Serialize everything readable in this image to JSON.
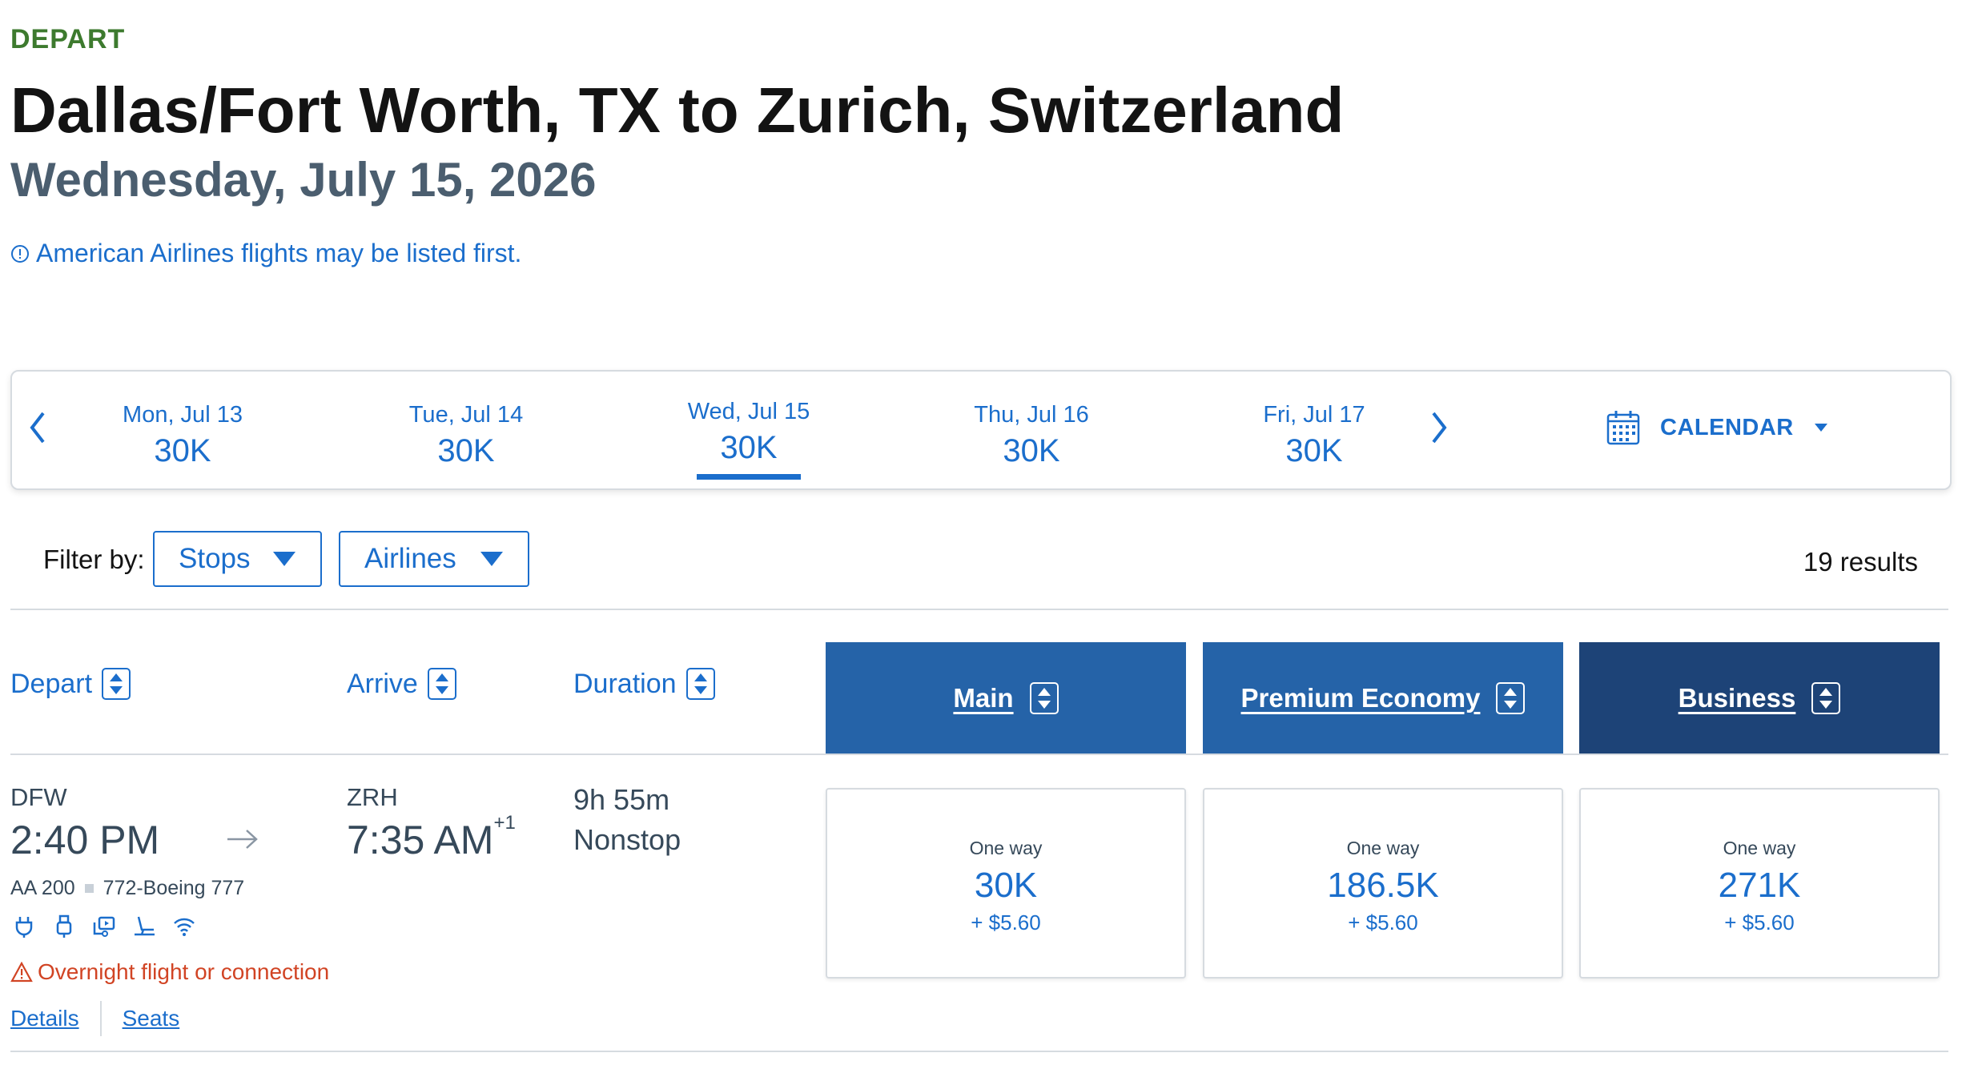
{
  "header": {
    "direction_label": "DEPART",
    "route_title": "Dallas/Fort Worth, TX to Zurich, Switzerland",
    "date": "Wednesday, July 15, 2026",
    "notice": "American Airlines flights may be listed first."
  },
  "date_carousel": {
    "prev_icon": "chevron-left-icon",
    "next_icon": "chevron-right-icon",
    "dates": [
      {
        "label": "Mon, Jul 13",
        "price": "30K"
      },
      {
        "label": "Tue, Jul 14",
        "price": "30K"
      },
      {
        "label": "Wed, Jul 15",
        "price": "30K",
        "selected": true
      },
      {
        "label": "Thu, Jul 16",
        "price": "30K"
      },
      {
        "label": "Fri, Jul 17",
        "price": "30K"
      }
    ],
    "calendar_label": "CALENDAR",
    "calendar_icon": "calendar-icon"
  },
  "filters": {
    "label": "Filter by:",
    "stops": "Stops",
    "airlines": "Airlines",
    "results": "19 results"
  },
  "columns": {
    "depart": "Depart",
    "arrive": "Arrive",
    "duration": "Duration",
    "cabins": [
      {
        "label": "Main",
        "color": "#2563a8"
      },
      {
        "label": "Premium Economy",
        "color": "#2563a8"
      },
      {
        "label": "Business",
        "color": "#1d4377"
      }
    ]
  },
  "flight": {
    "origin": "DFW",
    "depart_time": "2:40 PM",
    "destination": "ZRH",
    "arrive_time": "7:35 AM",
    "day_offset": "+1",
    "duration": "9h 55m",
    "stops": "Nonstop",
    "flight_number": "AA 200",
    "aircraft": "772-Boeing 777",
    "amenities": [
      "power-outlet-icon",
      "usb-icon",
      "entertainment-icon",
      "lie-flat-seat-icon",
      "wifi-icon"
    ],
    "warning": "Overnight flight or connection",
    "details_link": "Details",
    "seats_link": "Seats",
    "fares": [
      {
        "cabin": "Main",
        "label": "One way",
        "miles": "30K",
        "tax": "+ $5.60"
      },
      {
        "cabin": "Premium Economy",
        "label": "One way",
        "miles": "186.5K",
        "tax": "+ $5.60"
      },
      {
        "cabin": "Business",
        "label": "One way",
        "miles": "271K",
        "tax": "+ $5.60"
      }
    ]
  },
  "colors": {
    "accent": "#1b6ecc",
    "depart_label": "#3d7a2e",
    "warning": "#d14424"
  }
}
